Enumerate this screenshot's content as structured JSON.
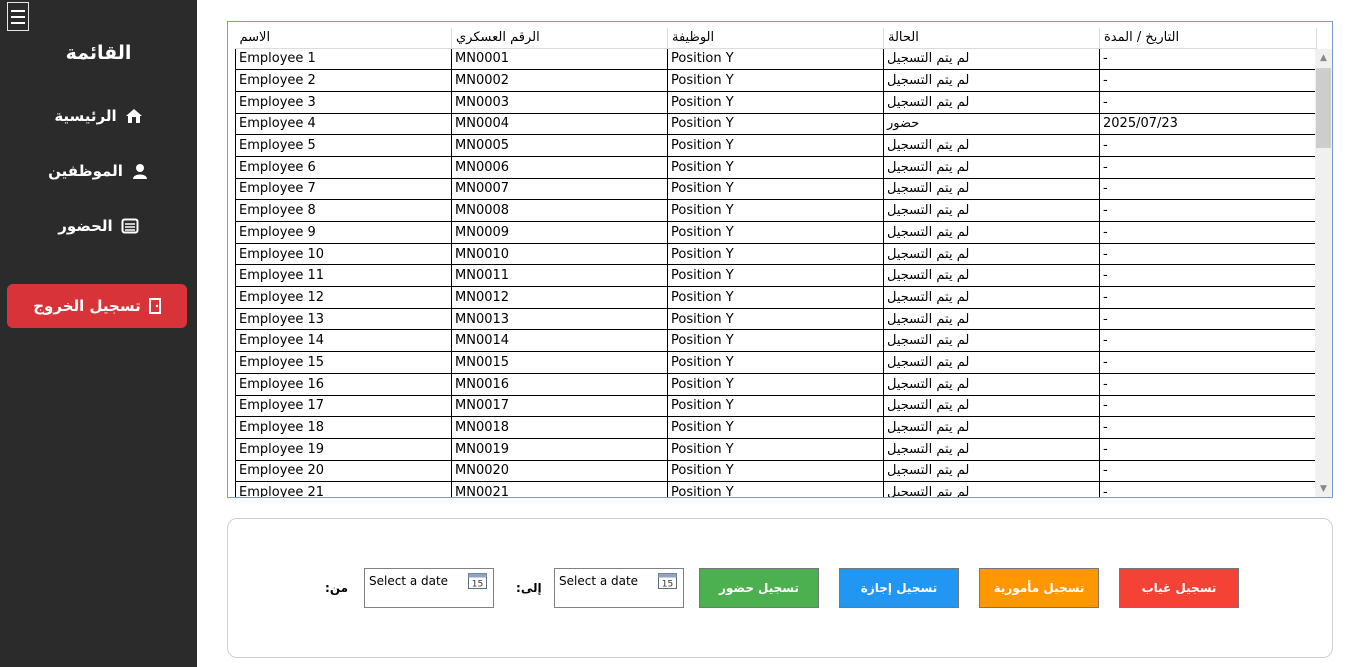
{
  "sidebar": {
    "title": "القائمة",
    "items": [
      {
        "label": "الرئيسية",
        "icon": "home-icon"
      },
      {
        "label": "الموظفين",
        "icon": "user-icon"
      },
      {
        "label": "الحضور",
        "icon": "table-icon"
      }
    ],
    "logout_label": "تسجيل الخروج",
    "logout_icon": "exit-door-icon",
    "logout_color": "#d9333a"
  },
  "grid": {
    "columns": [
      "الاسم",
      "الرقم العسكري",
      "الوظيفة",
      "الحالة",
      "التاريخ / المدة"
    ],
    "rows": [
      [
        "Employee 1",
        "MN0001",
        "Position Y",
        "لم يتم التسجيل",
        "-"
      ],
      [
        "Employee 2",
        "MN0002",
        "Position Y",
        "لم يتم التسجيل",
        "-"
      ],
      [
        "Employee 3",
        "MN0003",
        "Position Y",
        "لم يتم التسجيل",
        "-"
      ],
      [
        "Employee 4",
        "MN0004",
        "Position Y",
        "حضور",
        "2025/07/23"
      ],
      [
        "Employee 5",
        "MN0005",
        "Position Y",
        "لم يتم التسجيل",
        "-"
      ],
      [
        "Employee 6",
        "MN0006",
        "Position Y",
        "لم يتم التسجيل",
        "-"
      ],
      [
        "Employee 7",
        "MN0007",
        "Position Y",
        "لم يتم التسجيل",
        "-"
      ],
      [
        "Employee 8",
        "MN0008",
        "Position Y",
        "لم يتم التسجيل",
        "-"
      ],
      [
        "Employee 9",
        "MN0009",
        "Position Y",
        "لم يتم التسجيل",
        "-"
      ],
      [
        "Employee 10",
        "MN0010",
        "Position Y",
        "لم يتم التسجيل",
        "-"
      ],
      [
        "Employee 11",
        "MN0011",
        "Position Y",
        "لم يتم التسجيل",
        "-"
      ],
      [
        "Employee 12",
        "MN0012",
        "Position Y",
        "لم يتم التسجيل",
        "-"
      ],
      [
        "Employee 13",
        "MN0013",
        "Position Y",
        "لم يتم التسجيل",
        "-"
      ],
      [
        "Employee 14",
        "MN0014",
        "Position Y",
        "لم يتم التسجيل",
        "-"
      ],
      [
        "Employee 15",
        "MN0015",
        "Position Y",
        "لم يتم التسجيل",
        "-"
      ],
      [
        "Employee 16",
        "MN0016",
        "Position Y",
        "لم يتم التسجيل",
        "-"
      ],
      [
        "Employee 17",
        "MN0017",
        "Position Y",
        "لم يتم التسجيل",
        "-"
      ],
      [
        "Employee 18",
        "MN0018",
        "Position Y",
        "لم يتم التسجيل",
        "-"
      ],
      [
        "Employee 19",
        "MN0019",
        "Position Y",
        "لم يتم التسجيل",
        "-"
      ],
      [
        "Employee 20",
        "MN0020",
        "Position Y",
        "لم يتم التسجيل",
        "-"
      ],
      [
        "Employee 21",
        "MN0021",
        "Position Y",
        "لم يتم التسجيل",
        "-"
      ]
    ]
  },
  "panel": {
    "from_label": ":من",
    "to_label": ":إلى",
    "from_placeholder": "Select a date",
    "to_placeholder": "Select a date",
    "buttons": [
      {
        "label": "تسجيل حضور",
        "color": "#4caf50"
      },
      {
        "label": "تسجيل إجازة",
        "color": "#2196f3"
      },
      {
        "label": "تسجيل مأمورية",
        "color": "#ff9800"
      },
      {
        "label": "تسجيل غياب",
        "color": "#f44336"
      }
    ]
  }
}
